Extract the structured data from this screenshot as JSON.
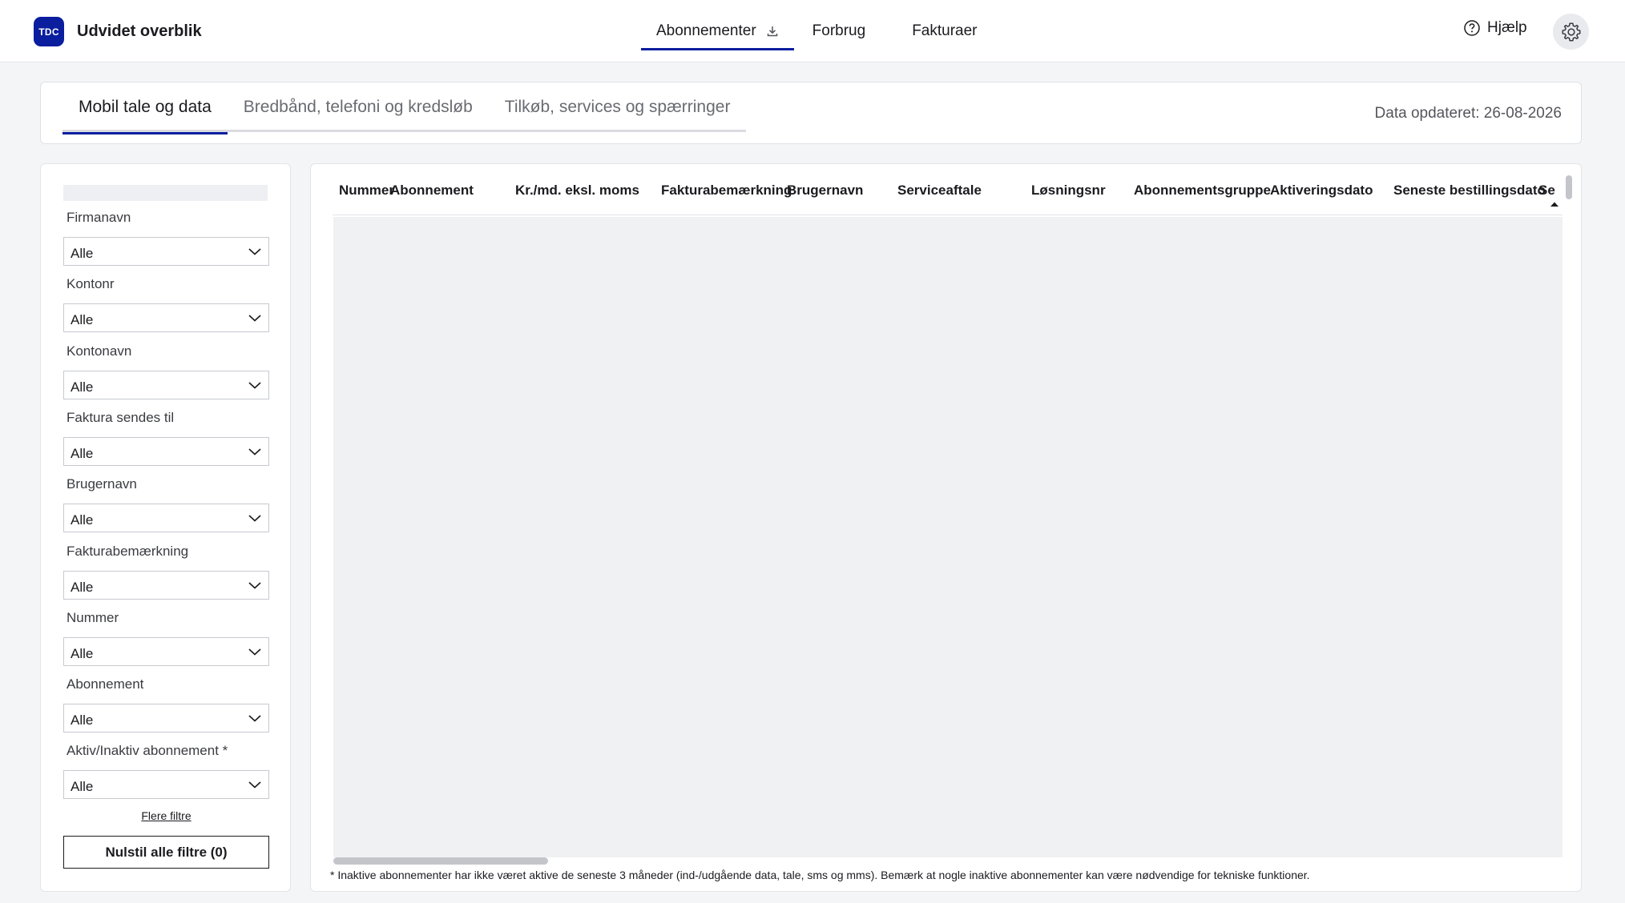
{
  "app": {
    "logo_text": "TDC",
    "title": "Udvidet overblik"
  },
  "nav": {
    "items": [
      {
        "label": "Abonnementer",
        "active": true,
        "has_download_icon": true
      },
      {
        "label": "Forbrug",
        "active": false
      },
      {
        "label": "Fakturaer",
        "active": false
      }
    ],
    "help_label": "Hjælp"
  },
  "tabs": {
    "items": [
      {
        "label": "Mobil tale og data",
        "active": true
      },
      {
        "label": "Bredbånd, telefoni og kredsløb",
        "active": false
      },
      {
        "label": "Tilkøb, services og spærringer",
        "active": false
      }
    ],
    "updated_label": "Data opdateret: 26-08-2026"
  },
  "filters": {
    "items": [
      {
        "label": "Firmanavn",
        "value": "Alle"
      },
      {
        "label": "Kontonr",
        "value": "Alle"
      },
      {
        "label": "Kontonavn",
        "value": "Alle"
      },
      {
        "label": "Faktura sendes til",
        "value": "Alle"
      },
      {
        "label": "Brugernavn",
        "value": "Alle"
      },
      {
        "label": "Fakturabemærkning",
        "value": "Alle"
      },
      {
        "label": "Nummer",
        "value": "Alle"
      },
      {
        "label": "Abonnement",
        "value": "Alle"
      },
      {
        "label": "Aktiv/Inaktiv abonnement *",
        "value": "Alle"
      }
    ],
    "more_label": "Flere filtre",
    "reset_label": "Nulstil alle filtre (0)"
  },
  "table": {
    "columns": [
      "Nummer",
      "Abonnement",
      "Kr./md. eksl. moms",
      "Fakturabemærkning",
      "Brugernavn",
      "Serviceaftale",
      "Løsningsnr",
      "Abonnementsgruppe",
      "Aktiveringsdato",
      "Seneste bestillingsdato",
      "Se"
    ],
    "rows": [],
    "footnote": "* Inaktive abonnementer har ikke været aktive de seneste 3 måneder (ind-/udgående data, tale, sms og mms). Bemærk at nogle inaktive abonnementer kan være nødvendige for tekniske funktioner."
  },
  "colors": {
    "accent": "#0a1e9e",
    "background": "#f4f5f7",
    "table_placeholder": "#f0f1f3"
  }
}
